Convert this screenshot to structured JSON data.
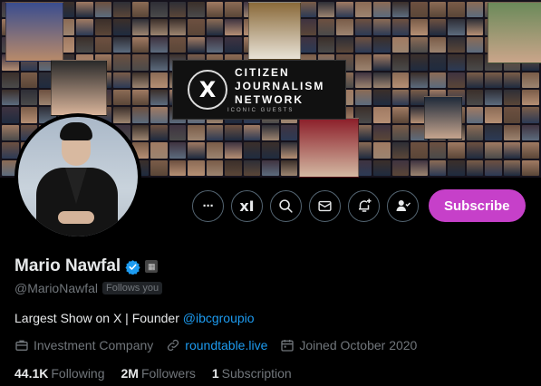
{
  "banner": {
    "logo_lines": [
      "CITIZEN",
      "JOURNALISM",
      "NETWORK"
    ],
    "logo_sub": "ICONIC GUESTS",
    "logo_glyph": "X"
  },
  "profile": {
    "name": "Mario Nawfal",
    "handle": "@MarioNawfal",
    "follows_you": "Follows you",
    "bio_text": "Largest Show on X | Founder ",
    "bio_link": "@ibcgroupio",
    "category": "Investment Company",
    "website": "roundtable.live",
    "joined": "Joined October 2020"
  },
  "actions": {
    "more": "···",
    "grok": "xI",
    "subscribe": "Subscribe"
  },
  "stats": {
    "following_count": "44.1K",
    "following_label": "Following",
    "followers_count": "2M",
    "followers_label": "Followers",
    "subscription_count": "1",
    "subscription_label": "Subscription"
  },
  "colors": {
    "accent_link": "#1d9bf0",
    "subscribe_bg": "#c640c9",
    "verified": "#1d9bf0"
  }
}
